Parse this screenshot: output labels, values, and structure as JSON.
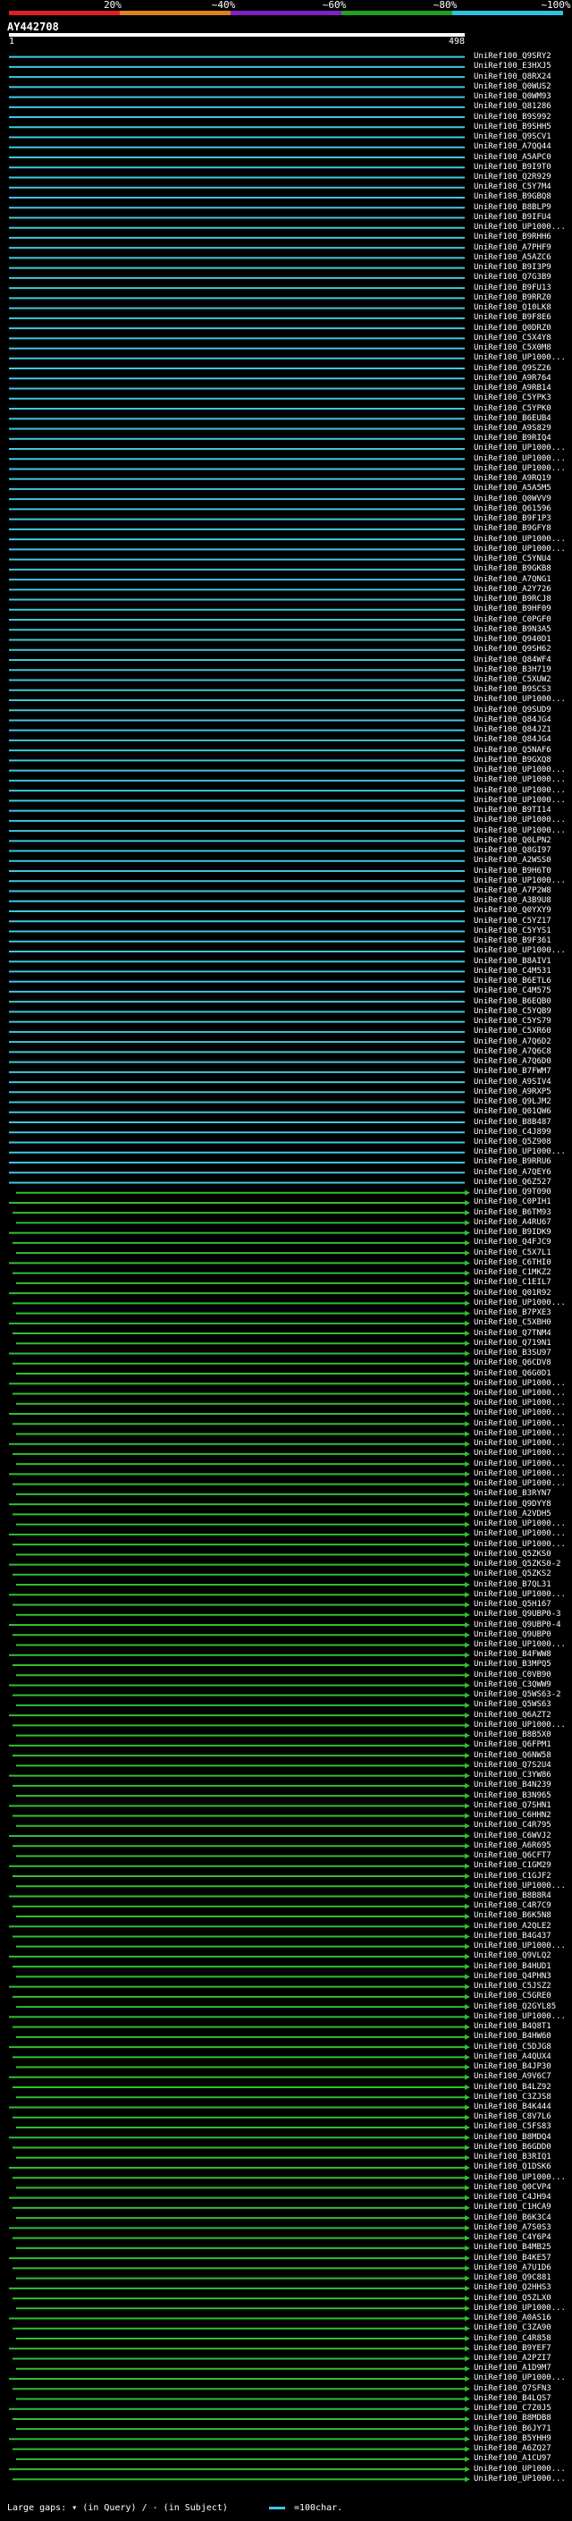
{
  "scale": {
    "labels": [
      "20%",
      "~40%",
      "~60%",
      "~80%",
      "~100%"
    ],
    "colors": [
      "#e02020",
      "#e08020",
      "#8020c0",
      "#20a020",
      "#30c0e0"
    ]
  },
  "query": {
    "accession": "AY442708",
    "start": "1",
    "end": "498"
  },
  "colors": {
    "high": "#40c8e0",
    "mid": "#30c030",
    "gap": "#141414",
    "marker": "#ffffff"
  },
  "hits": [
    "UniRef100_Q9SRY2",
    "UniRef100_E3HXJ5",
    "UniRef100_Q8RX24",
    "UniRef100_Q0WUS2",
    "UniRef100_Q0WM93",
    "UniRef100_Q81286",
    "UniRef100_B9S992",
    "UniRef100_B9SHH5",
    "UniRef100_Q9SCV1",
    "UniRef100_A7QQ44",
    "UniRef100_A5APC0",
    "UniRef100_B9I9T0",
    "UniRef100_Q2R929",
    "UniRef100_C5Y7M4",
    "UniRef100_B9GBQ8",
    "UniRef100_B8BLP9",
    "UniRef100_B9IFU4",
    "UniRef100_UP1000...",
    "UniRef100_B9RHH6",
    "UniRef100_A7PHF9",
    "UniRef100_A5AZC6",
    "UniRef100_B9I3P9",
    "UniRef100_Q7G3B9",
    "UniRef100_B9FU13",
    "UniRef100_B9RRZ0",
    "UniRef100_Q10LK8",
    "UniRef100_B9F8E6",
    "UniRef100_Q0DRZ0",
    "UniRef100_C5X4Y8",
    "UniRef100_C5X0M8",
    "UniRef100_UP1000...",
    "UniRef100_Q9SZ26",
    "UniRef100_A9R764",
    "UniRef100_A9RB14",
    "UniRef100_C5YPK3",
    "UniRef100_C5YPK0",
    "UniRef100_B6EUB4",
    "UniRef100_A9S829",
    "UniRef100_B9RIQ4",
    "UniRef100_UP1000...",
    "UniRef100_UP1000...",
    "UniRef100_UP1000...",
    "UniRef100_A9RQ19",
    "UniRef100_A5A5M5",
    "UniRef100_Q0WVV9",
    "UniRef100_Q61596",
    "UniRef100_B9F1P3",
    "UniRef100_B9GFY8",
    "UniRef100_UP1000...",
    "UniRef100_UP1000...",
    "UniRef100_C5YNU4",
    "UniRef100_B9GKB8",
    "UniRef100_A7QNG1",
    "UniRef100_A2Y726",
    "UniRef100_B9RCJ8",
    "UniRef100_B9HF09",
    "UniRef100_C0PGF0",
    "UniRef100_B9N3A5",
    "UniRef100_Q940D1",
    "UniRef100_Q9SH62",
    "UniRef100_Q84WF4",
    "UniRef100_B3H719",
    "UniRef100_C5XUW2",
    "UniRef100_B9SCS3",
    "UniRef100_UP1000...",
    "UniRef100_Q9SUD9",
    "UniRef100_Q84JG4",
    "UniRef100_Q84JZ1",
    "UniRef100_Q84JG4",
    "UniRef100_Q5NAF6",
    "UniRef100_B9GXQ8",
    "UniRef100_UP1000...",
    "UniRef100_UP1000...",
    "UniRef100_UP1000...",
    "UniRef100_UP1000...",
    "UniRef100_B9TI14",
    "UniRef100_UP1000...",
    "UniRef100_UP1000...",
    "UniRef100_Q0LPN2",
    "UniRef100_Q8GI97",
    "UniRef100_A2WSS0",
    "UniRef100_B9H6T0",
    "UniRef100_UP1000...",
    "UniRef100_A7P2W8",
    "UniRef100_A3B9U8",
    "UniRef100_Q0YXY9",
    "UniRef100_C5YZ17",
    "UniRef100_C5YYS1",
    "UniRef100_B9F361",
    "UniRef100_UP1000...",
    "UniRef100_B8AIV1",
    "UniRef100_C4M531",
    "UniRef100_B6ETL6",
    "UniRef100_C4M575",
    "UniRef100_B6EQB0",
    "UniRef100_C5YQB9",
    "UniRef100_C5YS79",
    "UniRef100_C5XR60",
    "UniRef100_A7Q6D2",
    "UniRef100_A7Q6C8",
    "UniRef100_A7Q6D0",
    "UniRef100_B7FWM7",
    "UniRef100_A9SIV4",
    "UniRef100_A9RXP5",
    "UniRef100_Q9LJM2",
    "UniRef100_Q01QW6",
    "UniRef100_B8B487",
    "UniRef100_C4J899",
    "UniRef100_Q5Z908",
    "UniRef100_UP1000...",
    "UniRef100_B9RRU6",
    "UniRef100_A7QEY6",
    "UniRef100_Q6Z527",
    "UniRef100_Q9T090",
    "UniRef100_C0PIH1",
    "UniRef100_B6TM93",
    "UniRef100_A4RU67",
    "UniRef100_B9IDK9",
    "UniRef100_Q4FJC9",
    "UniRef100_C5X7L1",
    "UniRef100_C6THI0",
    "UniRef100_C1MKZ2",
    "UniRef100_C1EIL7",
    "UniRef100_Q01R92",
    "UniRef100_UP1000...",
    "UniRef100_B7PXE3",
    "UniRef100_C5XBH0",
    "UniRef100_Q7TNM4",
    "UniRef100_Q719N1",
    "UniRef100_B3SU97",
    "UniRef100_Q6CDV8",
    "UniRef100_Q6G0D1",
    "UniRef100_UP1000...",
    "UniRef100_UP1000...",
    "UniRef100_UP1000...",
    "UniRef100_UP1000...",
    "UniRef100_UP1000...",
    "UniRef100_UP1000...",
    "UniRef100_UP1000...",
    "UniRef100_UP1000...",
    "UniRef100_UP1000...",
    "UniRef100_UP1000...",
    "UniRef100_UP1000...",
    "UniRef100_B3RYN7",
    "UniRef100_Q9DYY8",
    "UniRef100_A2VDH5",
    "UniRef100_UP1000...",
    "UniRef100_UP1000...",
    "UniRef100_UP1000...",
    "UniRef100_Q5ZKS0",
    "UniRef100_Q5ZKS0-2",
    "UniRef100_Q5ZKS2",
    "UniRef100_B7QL31",
    "UniRef100_UP1000...",
    "UniRef100_Q5H167",
    "UniRef100_Q9UBP0-3",
    "UniRef100_Q9UBP0-4",
    "UniRef100_Q9UBP0",
    "UniRef100_UP1000...",
    "UniRef100_B4FWW8",
    "UniRef100_B3MPQ5",
    "UniRef100_C0VB90",
    "UniRef100_C3QWW9",
    "UniRef100_Q5WS63-2",
    "UniRef100_Q5WS63",
    "UniRef100_Q6AZT2",
    "UniRef100_UP1000...",
    "UniRef100_B8B5X0",
    "UniRef100_Q6FPM1",
    "UniRef100_Q6NW58",
    "UniRef100_Q7S2U4",
    "UniRef100_C3YW86",
    "UniRef100_B4N239",
    "UniRef100_B3N965",
    "UniRef100_Q7SHN1",
    "UniRef100_C6HHN2",
    "UniRef100_C4R795",
    "UniRef100_C6WVJ2",
    "UniRef100_A6R695",
    "UniRef100_Q6CFT7",
    "UniRef100_C1GM29",
    "UniRef100_C1GJF2",
    "UniRef100_UP1000...",
    "UniRef100_B8B8R4",
    "UniRef100_C4R7C9",
    "UniRef100_B6K5N8",
    "UniRef100_A2QLE2",
    "UniRef100_B4G437",
    "UniRef100_UP1000...",
    "UniRef100_Q9VLQ2",
    "UniRef100_B4HUD1",
    "UniRef100_Q4PHN3",
    "UniRef100_C5JSZ2",
    "UniRef100_C5GRE0",
    "UniRef100_Q2GYL85",
    "UniRef100_UP1000...",
    "UniRef100_B4Q8T1",
    "UniRef100_B4HW60",
    "UniRef100_C5DJG8",
    "UniRef100_A4QUX4",
    "UniRef100_B4JP30",
    "UniRef100_A9V6C7",
    "UniRef100_B4LZ92",
    "UniRef100_C3ZJS8",
    "UniRef100_B4K444",
    "UniRef100_C8V7L6",
    "UniRef100_C5FS83",
    "UniRef100_B8MDQ4",
    "UniRef100_B6GDD0",
    "UniRef100_B3RIQ1",
    "UniRef100_Q1DSK6",
    "UniRef100_UP1000...",
    "UniRef100_Q0CVP4",
    "UniRef100_C4JH94",
    "UniRef100_C1HCA9",
    "UniRef100_B6K3C4",
    "UniRef100_A7S0S3",
    "UniRef100_C4Y6P4",
    "UniRef100_B4MB25",
    "UniRef100_B4KE57",
    "UniRef100_A7U1D6",
    "UniRef100_Q9C881",
    "UniRef100_Q2HHS3",
    "UniRef100_Q5ZLX0",
    "UniRef100_UP1000...",
    "UniRef100_A0AS16",
    "UniRef100_C3ZA90",
    "UniRef100_C4R858",
    "UniRef100_B9YEF7",
    "UniRef100_A2PZI7",
    "UniRef100_A1D9M7",
    "UniRef100_UP1000...",
    "UniRef100_Q7SFN3",
    "UniRef100_B4LQS7",
    "UniRef100_C7Z0J5",
    "UniRef100_B8MDB8",
    "UniRef100_B6JY71",
    "UniRef100_B5YHH9",
    "UniRef100_A6ZQ27",
    "UniRef100_A1CU97",
    "UniRef100_UP1000...",
    "UniRef100_UP1000..."
  ],
  "legend": {
    "gaps_title": "Large gaps:",
    "query_gap": "(in Query)",
    "subject_gap": "(in Subject)",
    "key_label": "=100char."
  }
}
